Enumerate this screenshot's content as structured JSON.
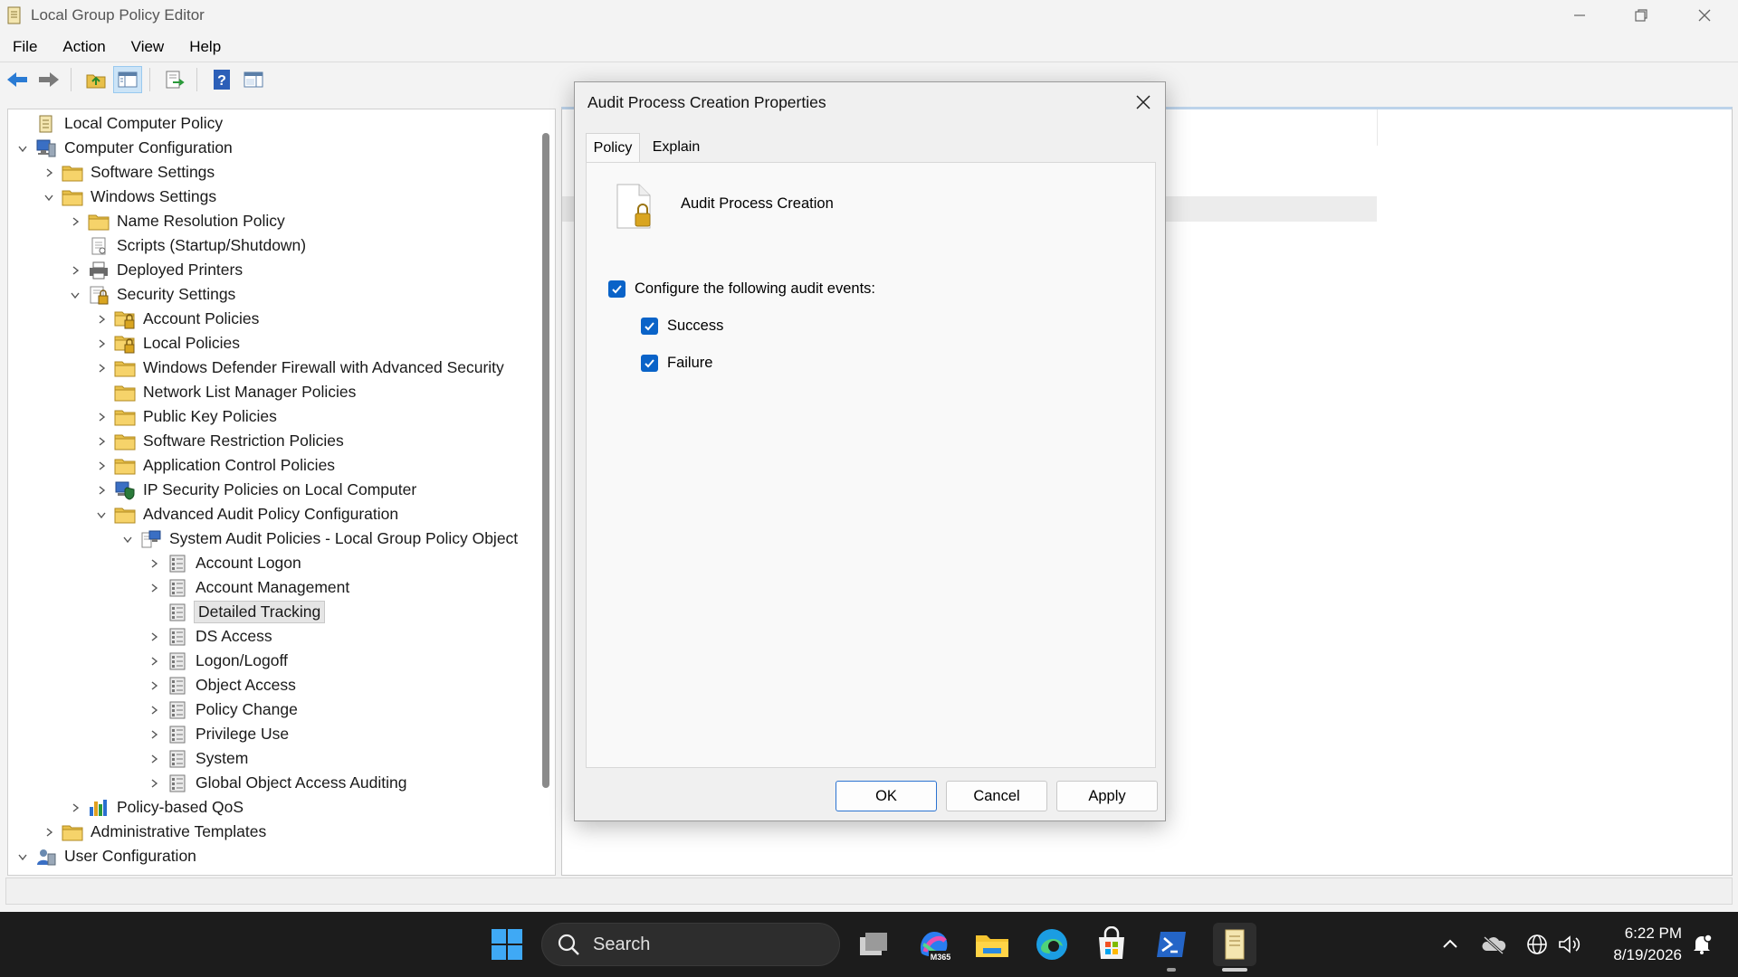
{
  "window": {
    "title": "Local Group Policy Editor",
    "icon": "policy-scroll-icon"
  },
  "menu": [
    "File",
    "Action",
    "View",
    "Help"
  ],
  "toolbar": {
    "icons": [
      "back-arrow-icon",
      "forward-arrow-icon",
      "up-folder-icon",
      "show-hide-tree-icon",
      "export-list-icon",
      "help-icon",
      "properties-pane-icon"
    ]
  },
  "tree": {
    "items": [
      {
        "label": "Local Computer Policy",
        "icon": "policy-scroll-icon"
      },
      {
        "label": "Computer Configuration",
        "icon": "computer-icon"
      },
      {
        "label": "Software Settings",
        "icon": "folder-icon"
      },
      {
        "label": "Windows Settings",
        "icon": "folder-icon"
      },
      {
        "label": "Name Resolution Policy",
        "icon": "folder-icon"
      },
      {
        "label": "Scripts (Startup/Shutdown)",
        "icon": "script-icon"
      },
      {
        "label": "Deployed Printers",
        "icon": "printer-icon"
      },
      {
        "label": "Security Settings",
        "icon": "security-icon"
      },
      {
        "label": "Account Policies",
        "icon": "locked-folder-icon"
      },
      {
        "label": "Local Policies",
        "icon": "locked-folder-icon"
      },
      {
        "label": "Windows Defender Firewall with Advanced Security",
        "icon": "folder-icon"
      },
      {
        "label": "Network List Manager Policies",
        "icon": "folder-icon"
      },
      {
        "label": "Public Key Policies",
        "icon": "folder-icon"
      },
      {
        "label": "Software Restriction Policies",
        "icon": "folder-icon"
      },
      {
        "label": "Application Control Policies",
        "icon": "folder-icon"
      },
      {
        "label": "IP Security Policies on Local Computer",
        "icon": "ip-security-icon"
      },
      {
        "label": "Advanced Audit Policy Configuration",
        "icon": "folder-icon"
      },
      {
        "label": "System Audit Policies - Local Group Policy Object",
        "icon": "audit-computer-icon"
      },
      {
        "label": "Account Logon",
        "icon": "audit-list-icon"
      },
      {
        "label": "Account Management",
        "icon": "audit-list-icon"
      },
      {
        "label": "Detailed Tracking",
        "icon": "audit-list-icon"
      },
      {
        "label": "DS Access",
        "icon": "audit-list-icon"
      },
      {
        "label": "Logon/Logoff",
        "icon": "audit-list-icon"
      },
      {
        "label": "Object Access",
        "icon": "audit-list-icon"
      },
      {
        "label": "Policy Change",
        "icon": "audit-list-icon"
      },
      {
        "label": "Privilege Use",
        "icon": "audit-list-icon"
      },
      {
        "label": "System",
        "icon": "audit-list-icon"
      },
      {
        "label": "Global Object Access Auditing",
        "icon": "audit-list-icon"
      },
      {
        "label": "Policy-based QoS",
        "icon": "bar-chart-icon"
      },
      {
        "label": "Administrative Templates",
        "icon": "folder-icon"
      },
      {
        "label": "User Configuration",
        "icon": "user-icon"
      }
    ],
    "selected": "Detailed Tracking"
  },
  "dialog": {
    "title": "Audit Process Creation Properties",
    "tabs": [
      "Policy",
      "Explain"
    ],
    "active_tab": "Policy",
    "policy_name": "Audit Process Creation",
    "configure_label": "Configure the following audit events:",
    "configure_checked": true,
    "success_label": "Success",
    "success_checked": true,
    "failure_label": "Failure",
    "failure_checked": true,
    "buttons": {
      "ok": "OK",
      "cancel": "Cancel",
      "apply": "Apply"
    }
  },
  "taskbar": {
    "search_placeholder": "Search",
    "apps": [
      "windows-start-icon",
      "task-view-icon",
      "m365-copilot-icon",
      "file-explorer-icon",
      "edge-icon",
      "microsoft-store-icon",
      "terminal-icon",
      "group-policy-app-icon"
    ],
    "m365_badge": "M365",
    "time": "6:22 PM",
    "date": "8/19/2026",
    "tray_icons": [
      "chevron-up-icon",
      "onedrive-offline-icon",
      "network-globe-icon",
      "volume-icon",
      "notification-icon"
    ]
  },
  "colors": {
    "accent": "#0a63c8",
    "taskbar": "#1c1c1c",
    "selection": "#e5e5e5"
  }
}
